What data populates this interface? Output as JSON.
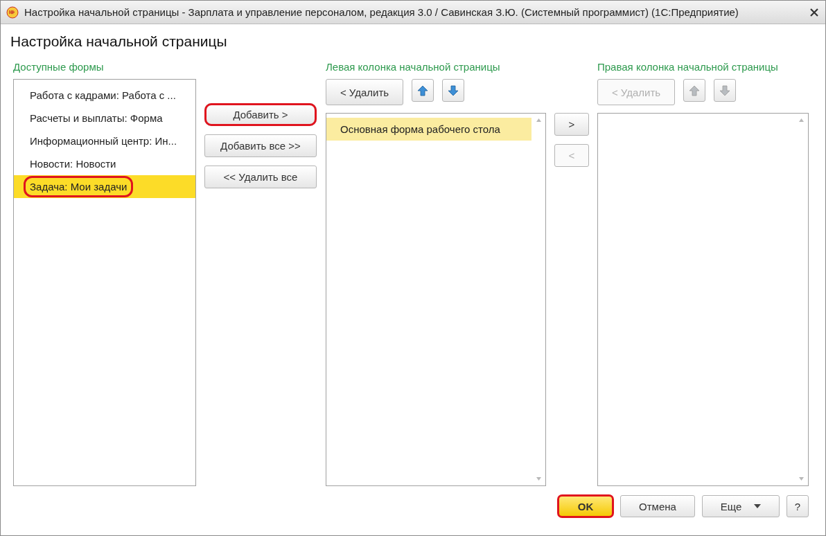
{
  "window": {
    "title": "Настройка начальной страницы - Зарплата и управление персоналом, редакция 3.0 / Савинская З.Ю. (Системный программист)  (1С:Предприятие)"
  },
  "heading": "Настройка начальной страницы",
  "available": {
    "label": "Доступные формы",
    "items": [
      {
        "text": "Работа с кадрами: Работа с ...",
        "selected": false,
        "annotated": false
      },
      {
        "text": "Расчеты и выплаты: Форма",
        "selected": false,
        "annotated": false
      },
      {
        "text": "Информационный центр: Ин...",
        "selected": false,
        "annotated": false
      },
      {
        "text": "Новости: Новости",
        "selected": false,
        "annotated": false
      },
      {
        "text": "Задача: Мои задачи",
        "selected": true,
        "annotated": true
      }
    ]
  },
  "transfer_buttons": [
    {
      "label": "Добавить >",
      "annotated": true
    },
    {
      "label": "Добавить все >>",
      "annotated": false
    },
    {
      "label": "<< Удалить все",
      "annotated": false
    }
  ],
  "left_column": {
    "label": "Левая колонка начальной страницы",
    "remove": {
      "label": "< Удалить",
      "disabled": false
    },
    "arrows": [
      {
        "kind": "up",
        "disabled": false
      },
      {
        "kind": "down",
        "disabled": false
      }
    ],
    "items": [
      {
        "text": "Основная форма рабочего стола",
        "selected": true
      }
    ]
  },
  "move_buttons": [
    {
      "label": ">",
      "disabled": false
    },
    {
      "label": "<",
      "disabled": true
    }
  ],
  "right_column": {
    "label": "Правая колонка начальной страницы",
    "remove": {
      "label": "< Удалить",
      "disabled": true
    },
    "arrows": [
      {
        "kind": "up",
        "disabled": true
      },
      {
        "kind": "down",
        "disabled": true
      }
    ]
  },
  "footer": [
    {
      "label": "OK",
      "kind": "default",
      "annotated": true
    },
    {
      "label": "Отмена",
      "kind": "plain",
      "annotated": false
    },
    {
      "label": "Еще",
      "kind": "menu",
      "annotated": false
    },
    {
      "label": "?",
      "kind": "help",
      "annotated": false
    }
  ]
}
